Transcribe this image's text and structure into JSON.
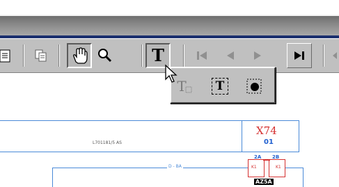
{
  "toolbar": {
    "buttons": [
      {
        "icon": "clipboard-icon"
      },
      {
        "icon": "copy-icon"
      },
      {
        "icon": "hand-pan-icon",
        "state": "pressed"
      },
      {
        "icon": "zoom-icon"
      },
      {
        "icon": "text-tool-icon",
        "state": "pressed",
        "label": "T"
      },
      {
        "icon": "first-page-icon",
        "state": "disabled"
      },
      {
        "icon": "prev-page-icon",
        "state": "disabled"
      },
      {
        "icon": "next-page-icon",
        "state": "disabled"
      },
      {
        "icon": "last-page-icon"
      }
    ]
  },
  "flyout": {
    "items": [
      {
        "icon": "text-box-icon",
        "label": "T"
      },
      {
        "icon": "text-frame-icon",
        "label": "T"
      },
      {
        "icon": "object-frame-icon"
      }
    ]
  },
  "drawing": {
    "wire_label": "L701181/5 AS",
    "component_ref": "X74",
    "component_sub": "01",
    "bus_label": "D - BA",
    "terminal_tags": [
      "2A",
      "2B"
    ],
    "terminal_small": [
      "K1",
      "K1"
    ],
    "bottom_tag": "AZ5A"
  },
  "colors": {
    "titlebar_stripe": "#1a2f6e",
    "wire_blue": "#4a8ad8",
    "component_red": "#d43030"
  }
}
